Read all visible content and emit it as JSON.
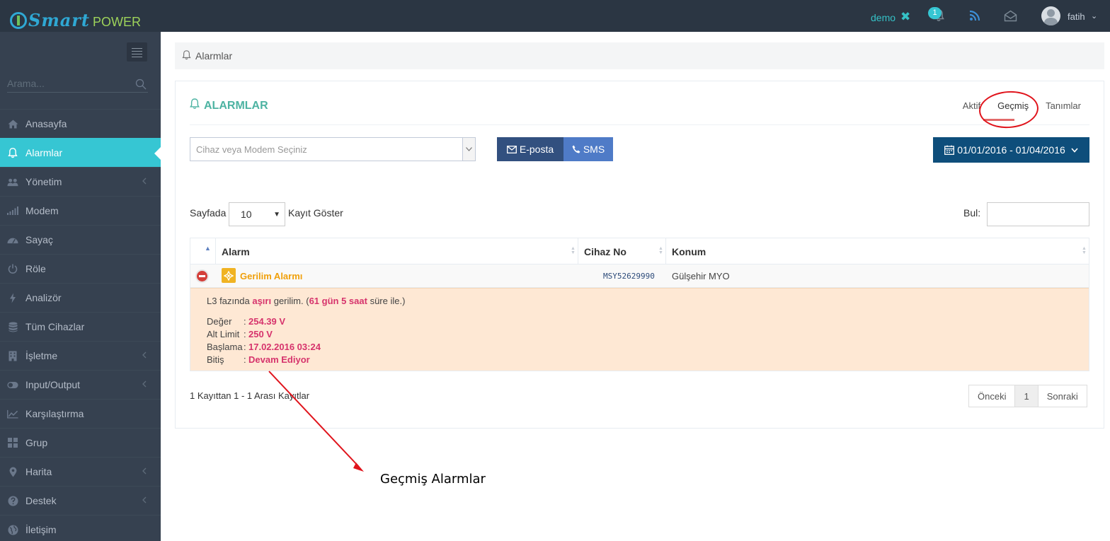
{
  "app": {
    "logo_smart": "Smart",
    "logo_power": "POWER"
  },
  "topbar": {
    "company": "demo",
    "notification_count": "1",
    "user_name": "fatih"
  },
  "sidebar": {
    "search_placeholder": "Arama...",
    "items": [
      {
        "label": "Anasayfa",
        "icon": "home-icon",
        "has_arrow": false
      },
      {
        "label": "Alarmlar",
        "icon": "bell-icon",
        "has_arrow": false,
        "active": true
      },
      {
        "label": "Yönetim",
        "icon": "users-icon",
        "has_arrow": true
      },
      {
        "label": "Modem",
        "icon": "signal-icon",
        "has_arrow": false
      },
      {
        "label": "Sayaç",
        "icon": "dashboard-icon",
        "has_arrow": false
      },
      {
        "label": "Röle",
        "icon": "power-icon",
        "has_arrow": false
      },
      {
        "label": "Analizör",
        "icon": "bolt-icon",
        "has_arrow": false
      },
      {
        "label": "Tüm Cihazlar",
        "icon": "database-icon",
        "has_arrow": false
      },
      {
        "label": "İşletme",
        "icon": "building-icon",
        "has_arrow": true
      },
      {
        "label": "Input/Output",
        "icon": "toggle-icon",
        "has_arrow": true
      },
      {
        "label": "Karşılaştırma",
        "icon": "line-chart-icon",
        "has_arrow": false
      },
      {
        "label": "Grup",
        "icon": "grid-icon",
        "has_arrow": false
      },
      {
        "label": "Harita",
        "icon": "map-marker-icon",
        "has_arrow": true
      },
      {
        "label": "Destek",
        "icon": "question-icon",
        "has_arrow": true
      },
      {
        "label": "İletişim",
        "icon": "globe-icon",
        "has_arrow": false
      }
    ]
  },
  "breadcrumb": {
    "label": "Alarmlar"
  },
  "portlet": {
    "title": "ALARMLAR",
    "tabs": [
      {
        "label": "Aktif",
        "active": false
      },
      {
        "label": "Geçmiş",
        "active": true
      },
      {
        "label": "Tanımlar",
        "active": false
      }
    ],
    "device_select_placeholder": "Cihaz veya Modem Seçiniz",
    "email_button": "E-posta",
    "sms_button": "SMS",
    "date_range": "01/01/2016 - 01/04/2016"
  },
  "table_controls": {
    "length_prefix": "Sayfada",
    "length_value": "10",
    "length_suffix": "Kayıt Göster",
    "search_label": "Bul:"
  },
  "table": {
    "columns": [
      "Alarm",
      "Cihaz No",
      "Konum"
    ],
    "rows": [
      {
        "alarm": "Gerilim Alarmı",
        "cihaz_no": "MSY52629990",
        "konum": "Gülşehir MYO",
        "detail": {
          "prefix": "L3 fazında",
          "emph1": "aşırı",
          "middle": "gerilim. (",
          "duration": "61 gün 5 saat",
          "suffix": "süre ile.)",
          "fields": [
            {
              "label": "Değer",
              "value": "254.39 V"
            },
            {
              "label": "Alt Limit",
              "value": "250 V"
            },
            {
              "label": "Başlama",
              "value": "17.02.2016 03:24"
            },
            {
              "label": "Bitiş",
              "value": "Devam Ediyor"
            }
          ]
        }
      }
    ]
  },
  "footer": {
    "info": "1 Kayıttan 1 - 1 Arası Kayıtlar",
    "prev": "Önceki",
    "page": "1",
    "next": "Sonraki"
  },
  "annotation": {
    "text": "Geçmiş Alarmlar"
  },
  "colors": {
    "topbar": "#2b3643",
    "sidebar": "#364150",
    "accent": "#36c6d3",
    "title": "#4db3a2",
    "detail_bg": "#fee8d4",
    "highlight": "#d6336c",
    "annotation": "#e0141c"
  }
}
